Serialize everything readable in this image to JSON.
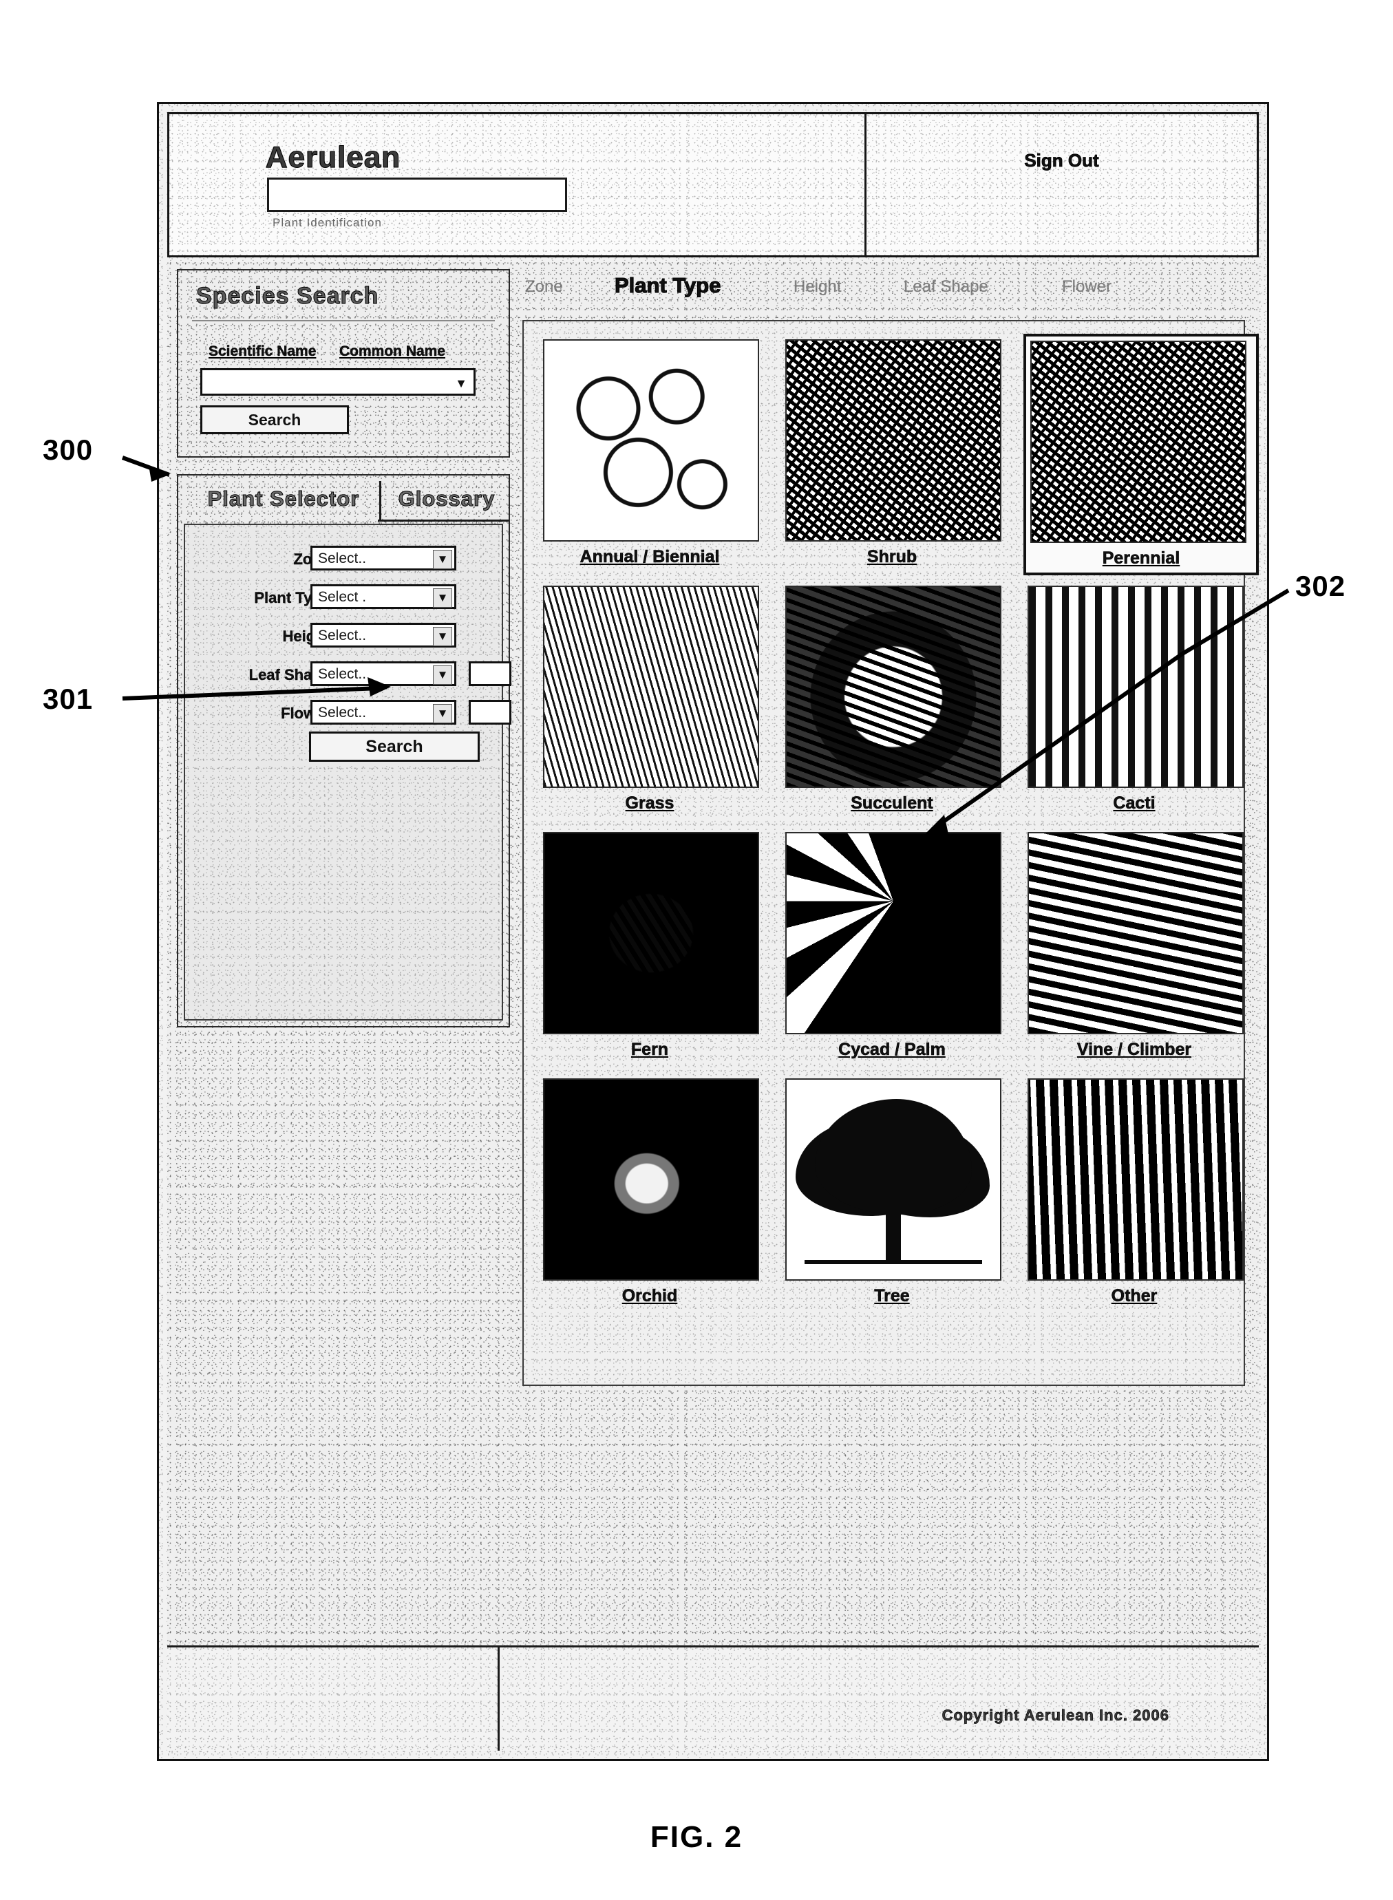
{
  "figure": {
    "caption": "FIG. 2",
    "callouts": [
      {
        "id": "300",
        "label": "300"
      },
      {
        "id": "301",
        "label": "301"
      },
      {
        "id": "302",
        "label": "302"
      }
    ]
  },
  "header": {
    "brand": "Aerulean",
    "brand_sub": "Plant Identification",
    "signout_label": "Sign Out"
  },
  "species_search": {
    "title": "Species Search",
    "tabs": [
      {
        "label": "Scientific Name"
      },
      {
        "label": "Common Name"
      }
    ],
    "input_value": "",
    "input_placeholder": "",
    "search_label": "Search"
  },
  "selector": {
    "tabs": [
      {
        "label": "Plant Selector",
        "active": true
      },
      {
        "label": "Glossary",
        "active": false
      }
    ],
    "fields": [
      {
        "label": "Zone",
        "value": "Select..",
        "extra": false
      },
      {
        "label": "Plant Type",
        "value": "Select .",
        "extra": false
      },
      {
        "label": "Height",
        "value": "Select..",
        "extra": false
      },
      {
        "label": "Leaf Shape",
        "value": "Select..",
        "extra": true
      },
      {
        "label": "Flower",
        "value": "Select..",
        "extra": true
      }
    ],
    "search_label": "Search"
  },
  "breadcrumbs": [
    {
      "label": "Zone",
      "active": false
    },
    {
      "label": "Plant Type",
      "active": true
    },
    {
      "label": "Height",
      "active": false
    },
    {
      "label": "Leaf Shape",
      "active": false
    },
    {
      "label": "Flower",
      "active": false
    }
  ],
  "tiles": [
    {
      "caption": "Annual / Biennial",
      "texture": "tx-flower",
      "selected": false
    },
    {
      "caption": "Shrub",
      "texture": "tx-dense",
      "selected": false
    },
    {
      "caption": "Perennial",
      "texture": "tx-dense",
      "selected": true
    },
    {
      "caption": "Grass",
      "texture": "tx-grass",
      "selected": false
    },
    {
      "caption": "Succulent",
      "texture": "tx-succ",
      "selected": false
    },
    {
      "caption": "Cacti",
      "texture": "tx-cacti",
      "selected": false
    },
    {
      "caption": "Fern",
      "texture": "tx-fern",
      "selected": false
    },
    {
      "caption": "Cycad / Palm",
      "texture": "tx-palm",
      "selected": false
    },
    {
      "caption": "Vine / Climber",
      "texture": "tx-vine",
      "selected": false
    },
    {
      "caption": "Orchid",
      "texture": "tx-orchid",
      "selected": false
    },
    {
      "caption": "Tree",
      "texture": "tx-tree",
      "selected": false
    },
    {
      "caption": "Other",
      "texture": "tx-other",
      "selected": false
    }
  ],
  "footer": {
    "copyright": "Copyright Aerulean Inc. 2006"
  },
  "icons": {
    "dropdown_caret": "▼",
    "combobox_caret": "▼"
  }
}
